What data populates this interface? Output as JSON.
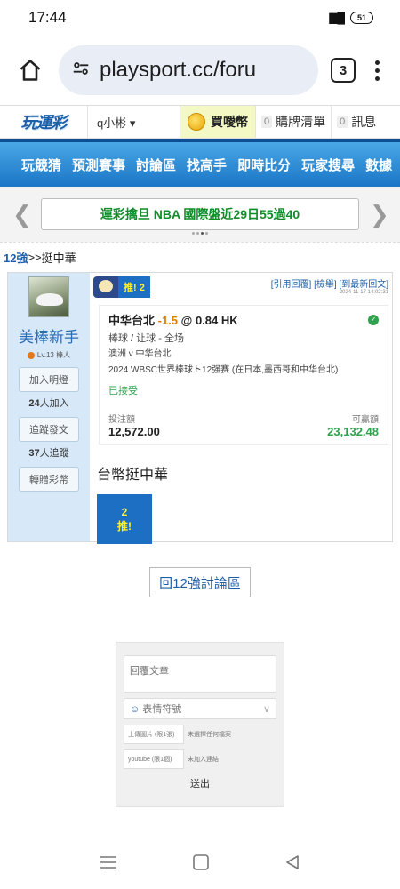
{
  "status": {
    "time": "17:44",
    "network": "⦿⁴ᴳ ▐▌",
    "battery": "51"
  },
  "browser": {
    "url": "playsport.cc/foru",
    "tab_count": "3"
  },
  "site": {
    "logo": "玩運彩",
    "user_dropdown": "q小彬 ▾",
    "buy_coin": "買噯幣",
    "cart_count": "0",
    "cart_label": "購牌清單",
    "msg_count": "0",
    "msg_label": "訊息"
  },
  "nav": [
    "玩競猜",
    "預測賽事",
    "討論區",
    "找高手",
    "即時比分",
    "玩家搜尋",
    "數據"
  ],
  "ticker": {
    "text": "運彩擒旦 NBA 國際盤近29日55過40"
  },
  "breadcrumb": {
    "forum": "12強",
    "sep": " >> ",
    "topic": "挺中華"
  },
  "post": {
    "author": "美棒新手",
    "level": "Lv.13 棒人",
    "follow_btn": "加入明燈",
    "follow_count": "24",
    "follow_suffix": "人加入",
    "track_btn": "追蹤發文",
    "track_count": "37",
    "track_suffix": "人追蹤",
    "gift_btn": "轉贈彩幣",
    "push_label": "推! 2",
    "actions": "[引用回覆] [檢舉] [到最新回文]",
    "timestamp": "2024-11-17 14:02:31",
    "pick_team": "中华台北",
    "pick_odds": "-1.5",
    "pick_price": "@ 0.84 HK",
    "pick_market": "棒球 / 让球 - 全场",
    "pick_match": "澳洲 v 中华台北",
    "pick_event": "2024 WBSC世界棒球ト12强赛 (在日本,墨西哥和中华台北)",
    "accepted": "已接受",
    "stake_label": "投注額",
    "stake": "12,572.00",
    "win_label": "可贏額",
    "win": "23,132.48",
    "title": "台幣挺中華",
    "pic_num": "2",
    "pic_label": "推!"
  },
  "back_button": "回12強討論區",
  "reply": {
    "placeholder": "回覆文章",
    "emoji": "表情符號",
    "upload_img": "上傳圖片 (限1張)",
    "upload_status": "未選擇任何檔案",
    "youtube": "youtube (限1個)",
    "youtube_status": "未加入連結",
    "submit": "送出"
  }
}
